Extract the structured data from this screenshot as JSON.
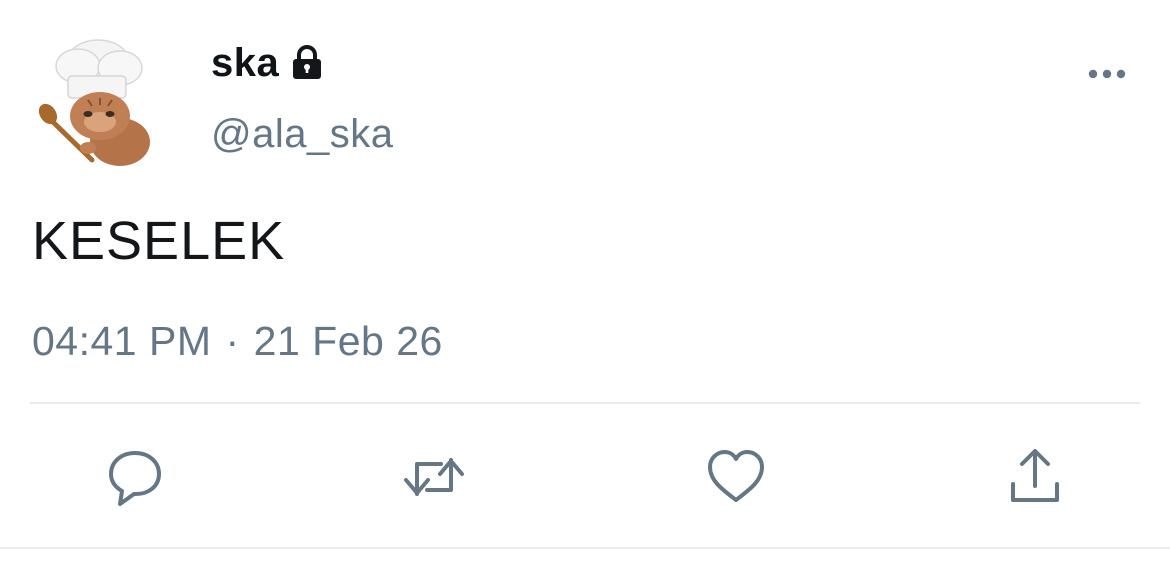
{
  "user": {
    "display_name": "ska",
    "handle": "@ala_ska",
    "protected_icon": "lock-icon",
    "avatar": "cat-chef-avatar"
  },
  "tweet": {
    "text": "KESELEK",
    "time": "04:41 PM",
    "separator": "·",
    "date": "21 Feb 26"
  },
  "actions": {
    "more": "more-options-icon",
    "reply": "reply-icon",
    "retweet": "retweet-icon",
    "like": "heart-icon",
    "share": "share-icon"
  },
  "colors": {
    "text_primary": "#14171a",
    "text_secondary": "#657786",
    "icon": "#657786",
    "divider": "#e6ecf0"
  }
}
